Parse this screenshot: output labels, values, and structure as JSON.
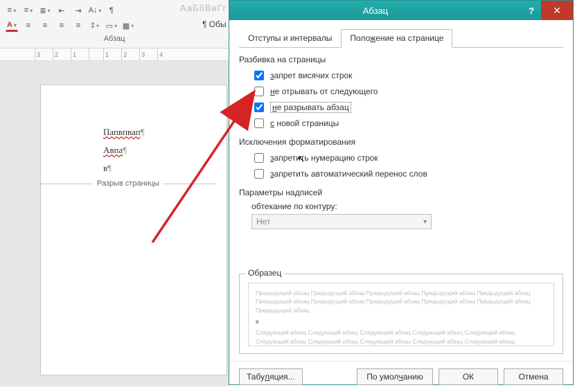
{
  "ribbon": {
    "group_label": "Абзац",
    "styles_blur": "АаБбВвГг  АаБбВвГг",
    "obj_label": "¶ Обы"
  },
  "ruler": [
    "3",
    "2",
    "1",
    "",
    "1",
    "2",
    "3",
    "4"
  ],
  "document": {
    "line1": "Папвпвап",
    "line2": "Авпа",
    "line3": "в",
    "page_break": "Разрыв страницы"
  },
  "dialog": {
    "title": "Абзац",
    "tabs": {
      "indents": "Отступы и интервалы",
      "position_pre": "Поло",
      "position_hot": "ж",
      "position_post": "ение на странице"
    },
    "section_pagination": "Разбивка на страницы",
    "opt_widow_pre": "з",
    "opt_widow_post": "апрет висячих строк",
    "opt_keep_next_pre": "н",
    "opt_keep_next_post": "е отрывать от следующего",
    "opt_keep_together_pre": "н",
    "opt_keep_together_post": "е разрывать абзац",
    "opt_page_before_pre": "с",
    "opt_page_before_post": " новой страницы",
    "section_formatting_exceptions": "Исключения форматирования",
    "opt_suppress_line_pre": "з",
    "opt_suppress_line_post": "апретить нумерацию строк",
    "opt_suppress_hyphen_pre": "з",
    "opt_suppress_hyphen_post": "апретить автоматический перенос слов",
    "section_textbox": "Параметры надписей",
    "wrap_label_pre": "о",
    "wrap_label_hot": "б",
    "wrap_label_post": "текание по контуру:",
    "wrap_value": "Нет",
    "preview_label_pre": "Образ",
    "preview_label_hot": "е",
    "preview_label_post": "ц",
    "preview_text_top": "Предыдущий абзац Предыдущий абзац Предыдущий абзац Предыдущий абзац Предыдущий абзац Предыдущий абзац Предыдущий абзац Предыдущий абзац Предыдущий абзац Предыдущий абзац Предыдущий абзац",
    "preview_bullet": "в",
    "preview_text_bottom": "Следующий абзац Следующий абзац Следующий абзац Следующий абзац Следующий абзац Следующий абзац Следующий абзац Следующий абзац Следующий абзац Следующий абзац",
    "btn_tabs_pre": "Табу",
    "btn_tabs_hot": "л",
    "btn_tabs_post": "яция...",
    "btn_default_pre": "По умол",
    "btn_default_hot": "ч",
    "btn_default_post": "анию",
    "btn_ok": "ОК",
    "btn_cancel": "Отмена"
  }
}
